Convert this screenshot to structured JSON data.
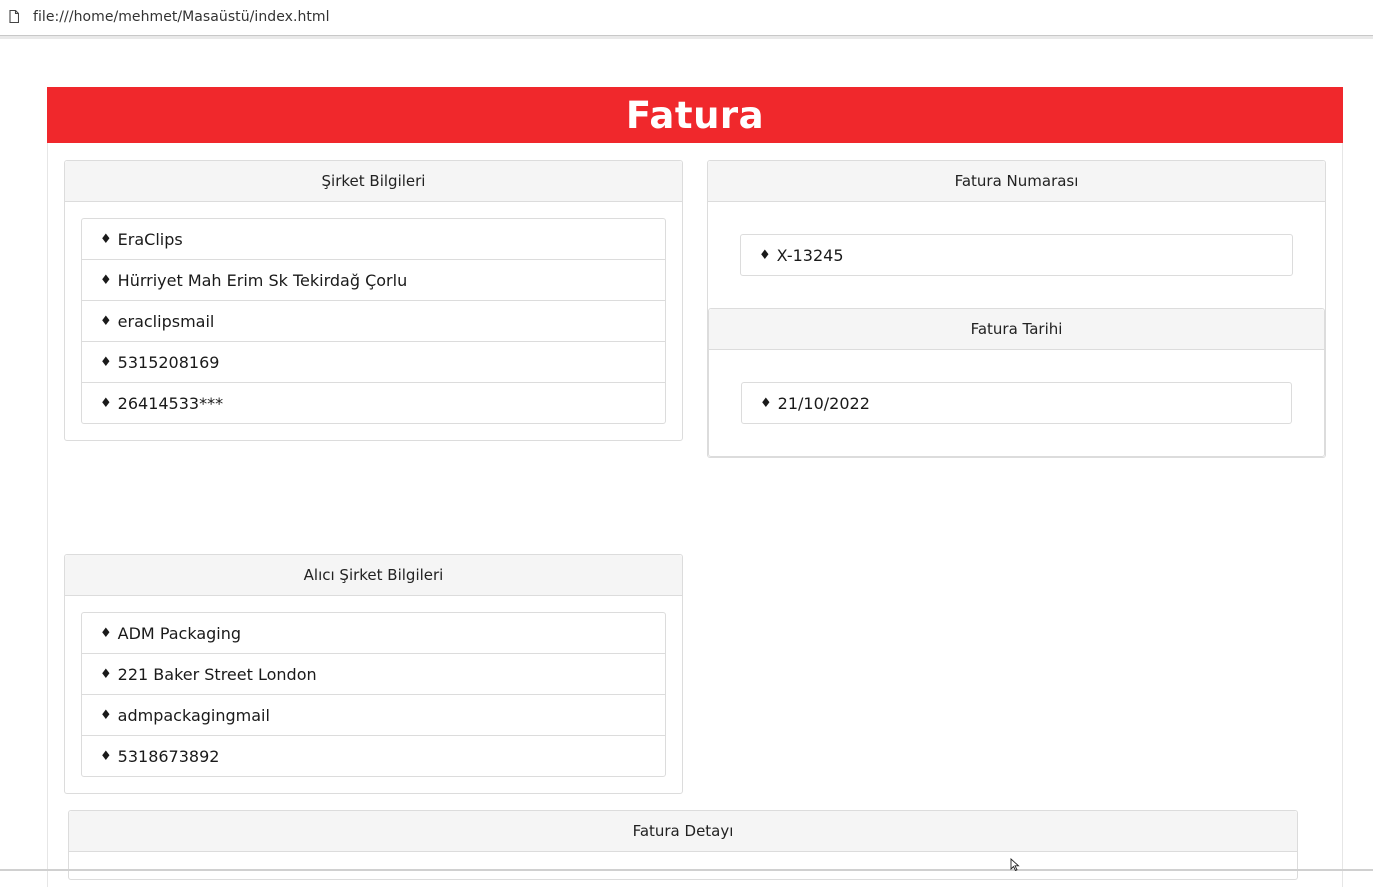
{
  "browser": {
    "url": "file:///home/mehmet/Masaüstü/index.html"
  },
  "page": {
    "title": "Fatura",
    "accent_color": "#f0282c"
  },
  "company_info": {
    "header": "Şirket Bilgileri",
    "items": [
      "EraClips",
      "Hürriyet Mah Erim Sk Tekirdağ Çorlu",
      "eraclipsmail",
      "5315208169",
      "26414533***"
    ]
  },
  "invoice_number": {
    "header": "Fatura Numarası",
    "items": [
      "X-13245"
    ]
  },
  "invoice_date": {
    "header": "Fatura Tarihi",
    "items": [
      "21/10/2022"
    ]
  },
  "buyer_info": {
    "header": "Alıcı Şirket Bilgileri",
    "items": [
      "ADM Packaging",
      "221 Baker Street London",
      "admpackagingmail",
      "5318673892"
    ]
  },
  "invoice_detail": {
    "header": "Fatura Detayı"
  },
  "bullet_icon": "♦"
}
